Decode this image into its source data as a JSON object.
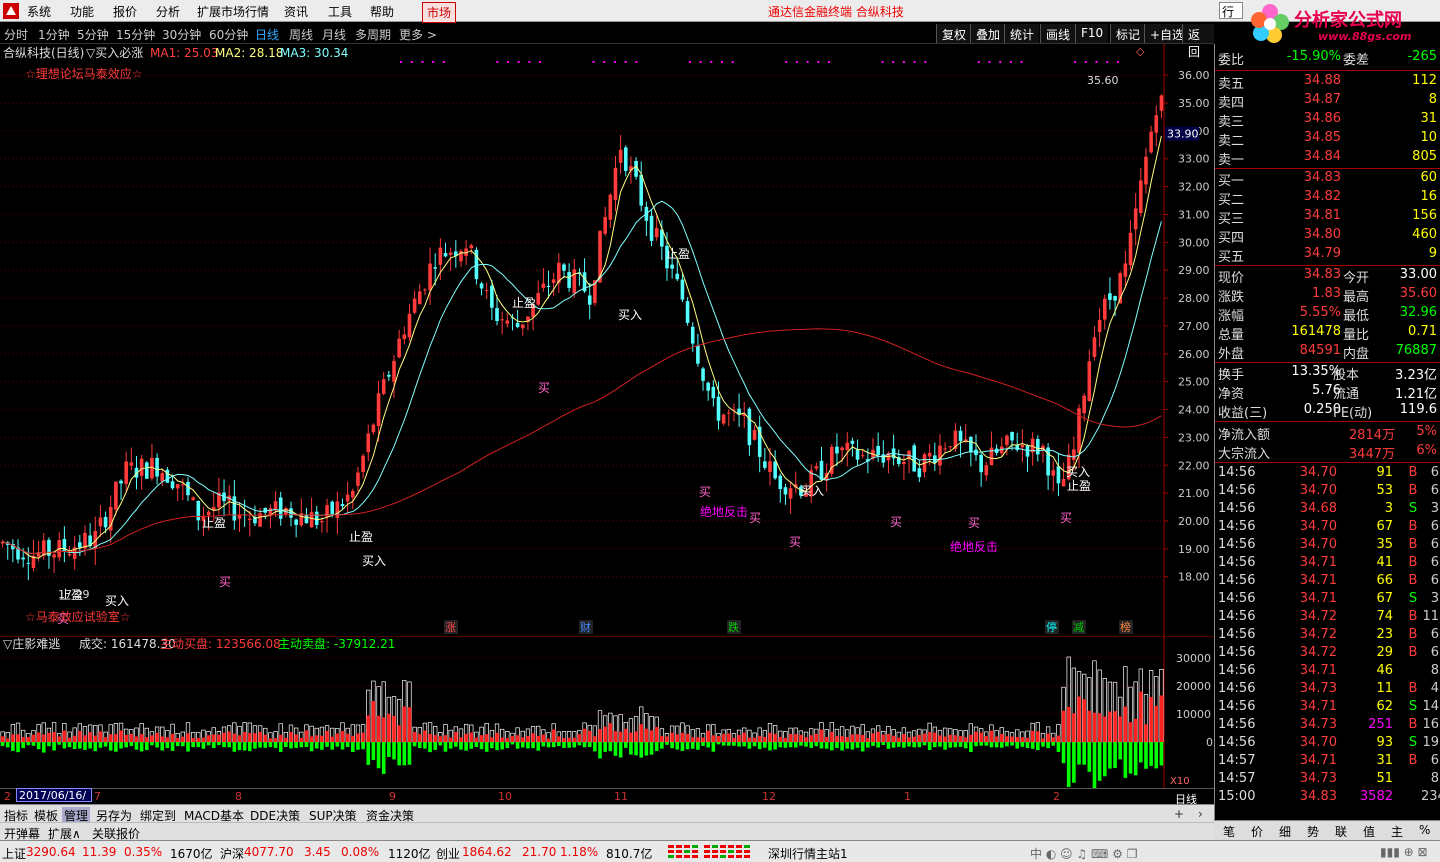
{
  "menubar": {
    "items": [
      "系统",
      "功能",
      "报价",
      "分析",
      "扩展市场行情",
      "资讯",
      "工具",
      "帮助"
    ],
    "market": "市场",
    "title": "通达信金融终端  合纵科技",
    "right_input": "行"
  },
  "brand": {
    "name": "分析家公式网",
    "url": "www.88gs.com"
  },
  "toolbar": {
    "periods": [
      "分时",
      "1分钟",
      "5分钟",
      "15分钟",
      "30分钟",
      "60分钟",
      "日线",
      "周线",
      "月线",
      "多周期",
      "更多 >"
    ],
    "active": "日线",
    "right": [
      "复权",
      "叠加",
      "统计",
      "画线",
      "F10",
      "标记",
      "+自选",
      "返回"
    ]
  },
  "chart_header": {
    "name": "合纵科技(日线)",
    "indicator": "▽买入必涨",
    "ma1": "MA1: 25.03",
    "ma2": "MA2: 28.18",
    "ma3": "MA3: 30.34",
    "note_top": "☆理想论坛马泰效应☆",
    "note_bottom": "☆马泰效应试验室☆",
    "diamond": "◇"
  },
  "colors": {
    "up": "#ff3b3b",
    "down": "#54ffff",
    "ma1": "#ffff80",
    "ma2": "#80ffff",
    "ma3": "#d02020",
    "grid": "#800000",
    "buy_vol": "#ff2020",
    "sell_vol": "#00ff00"
  },
  "price_axis": {
    "labels": [
      "36.00",
      "35.00",
      "34.00",
      "33.00",
      "32.00",
      "31.00",
      "30.00",
      "29.00",
      "28.00",
      "27.00",
      "26.00",
      "25.00",
      "24.00",
      "23.00",
      "22.00",
      "21.00",
      "20.00",
      "19.00",
      "18.00"
    ],
    "current": "33.90",
    "high_label": "35.60",
    "low_label": "17.29"
  },
  "annotations": {
    "zhiying": "止盈",
    "mairu": "买入",
    "mai": "买",
    "juedi": "绝地反击"
  },
  "events": [
    {
      "t": "涨",
      "c": "#f44"
    },
    {
      "t": "财",
      "c": "#48f"
    },
    {
      "t": "跌",
      "c": "#0c0"
    },
    {
      "t": "停",
      "c": "#0ff"
    },
    {
      "t": "减",
      "c": "#0c0"
    },
    {
      "t": "榜",
      "c": "#f84"
    }
  ],
  "ind_header": {
    "name": "▽庄影难逃",
    "vol": "成交: 161478.30",
    "buy": "主动买盘: 123566.08",
    "sell": "主动卖盘: -37912.21"
  },
  "ind_axis": {
    "labels": [
      "30000",
      "20000",
      "10000",
      "0"
    ],
    "mult": "X10"
  },
  "xaxis": {
    "date": "2017/06/16/五",
    "months": [
      "8",
      "9",
      "10",
      "11",
      "12",
      "1",
      "2"
    ],
    "left": "2",
    "left2": "7",
    "period": "日线"
  },
  "tabs1": [
    "指标",
    "模板",
    "管理",
    "另存为",
    "绑定到",
    "MACD基本",
    "DDE决策",
    "SUP决策",
    "资金决策"
  ],
  "tabs1_sel": "管理",
  "tabs2": [
    "开弹幕",
    "扩展∧",
    "关联报价"
  ],
  "statusbar": {
    "sh_label": "上证",
    "sh_val": "3290.64",
    "sh_chg": "11.39",
    "sh_pct": "0.35%",
    "sh_amt": "1670亿",
    "sz_label": "沪深",
    "sz_val": "4077.70",
    "sz_chg": "3.45",
    "sz_pct": "0.08%",
    "sz_amt": "1120亿",
    "cy_label": "创业",
    "cy_val": "1864.62",
    "cy_chg": "21.70",
    "cy_pct": "1.18%",
    "cy_amt": "810.7亿",
    "server": "深圳行情主站1"
  },
  "quote": {
    "weibi": {
      "label": "委比",
      "value": "-15.90%",
      "label2": "委差",
      "value2": "-265"
    },
    "asks": [
      {
        "l": "卖五",
        "p": "34.88",
        "v": "112"
      },
      {
        "l": "卖四",
        "p": "34.87",
        "v": "8"
      },
      {
        "l": "卖三",
        "p": "34.86",
        "v": "31"
      },
      {
        "l": "卖二",
        "p": "34.85",
        "v": "10"
      },
      {
        "l": "卖一",
        "p": "34.84",
        "v": "805"
      }
    ],
    "bids": [
      {
        "l": "买一",
        "p": "34.83",
        "v": "60"
      },
      {
        "l": "买二",
        "p": "34.82",
        "v": "16"
      },
      {
        "l": "买三",
        "p": "34.81",
        "v": "156"
      },
      {
        "l": "买四",
        "p": "34.80",
        "v": "460"
      },
      {
        "l": "买五",
        "p": "34.79",
        "v": "9"
      }
    ],
    "stats": [
      {
        "l": "现价",
        "v": "34.83",
        "vc": "red",
        "l2": "今开",
        "v2": "33.00",
        "v2c": "wht"
      },
      {
        "l": "涨跌",
        "v": "1.83",
        "vc": "red",
        "l2": "最高",
        "v2": "35.60",
        "v2c": "red"
      },
      {
        "l": "涨幅",
        "v": "5.55%",
        "vc": "red",
        "l2": "最低",
        "v2": "32.96",
        "v2c": "grn"
      },
      {
        "l": "总量",
        "v": "161478",
        "vc": "yel",
        "l2": "量比",
        "v2": "0.71",
        "v2c": "yel"
      },
      {
        "l": "外盘",
        "v": "84591",
        "vc": "red",
        "l2": "内盘",
        "v2": "76887",
        "v2c": "grn"
      }
    ],
    "stats2": [
      {
        "l": "换手",
        "v": "13.35%",
        "l2": "股本",
        "v2": "3.23亿"
      },
      {
        "l": "净资",
        "v": "5.76",
        "l2": "流通",
        "v2": "1.21亿"
      },
      {
        "l": "收益(三)",
        "v": "0.250",
        "l2": "PE(动)",
        "v2": "119.6"
      }
    ],
    "flows": [
      {
        "l": "净流入额",
        "v": "2814万",
        "p": "5%"
      },
      {
        "l": "大宗流入",
        "v": "3447万",
        "p": "6%"
      }
    ]
  },
  "ticks": [
    {
      "t": "14:56",
      "p": "34.70",
      "q": "91",
      "bs": "B",
      "n": "6"
    },
    {
      "t": "14:56",
      "p": "34.70",
      "q": "53",
      "bs": "B",
      "n": "6"
    },
    {
      "t": "14:56",
      "p": "34.68",
      "q": "3",
      "bs": "S",
      "n": "3"
    },
    {
      "t": "14:56",
      "p": "34.70",
      "q": "67",
      "bs": "B",
      "n": "6"
    },
    {
      "t": "14:56",
      "p": "34.70",
      "q": "35",
      "bs": "B",
      "n": "6"
    },
    {
      "t": "14:56",
      "p": "34.71",
      "q": "41",
      "bs": "B",
      "n": "6"
    },
    {
      "t": "14:56",
      "p": "34.71",
      "q": "66",
      "bs": "B",
      "n": "6"
    },
    {
      "t": "14:56",
      "p": "34.71",
      "q": "67",
      "bs": "S",
      "n": "3"
    },
    {
      "t": "14:56",
      "p": "34.72",
      "q": "74",
      "bs": "B",
      "n": "11"
    },
    {
      "t": "14:56",
      "p": "34.72",
      "q": "23",
      "bs": "B",
      "n": "6"
    },
    {
      "t": "14:56",
      "p": "34.72",
      "q": "29",
      "bs": "B",
      "n": "6"
    },
    {
      "t": "14:56",
      "p": "34.71",
      "q": "46",
      "bs": "",
      "n": "8"
    },
    {
      "t": "14:56",
      "p": "34.73",
      "q": "11",
      "bs": "B",
      "n": "4"
    },
    {
      "t": "14:56",
      "p": "34.71",
      "q": "62",
      "bs": "S",
      "n": "14"
    },
    {
      "t": "14:56",
      "p": "34.73",
      "q": "251",
      "bs": "B",
      "n": "16"
    },
    {
      "t": "14:56",
      "p": "34.70",
      "q": "93",
      "bs": "S",
      "n": "19"
    },
    {
      "t": "14:57",
      "p": "34.71",
      "q": "31",
      "bs": "B",
      "n": "6"
    },
    {
      "t": "14:57",
      "p": "34.73",
      "q": "51",
      "bs": "",
      "n": "8"
    },
    {
      "t": "15:00",
      "p": "34.83",
      "q": "3582",
      "bs": "",
      "n": "234"
    }
  ],
  "rtabs": [
    "笔",
    "价",
    "细",
    "势",
    "联",
    "值",
    "主",
    "%"
  ]
}
